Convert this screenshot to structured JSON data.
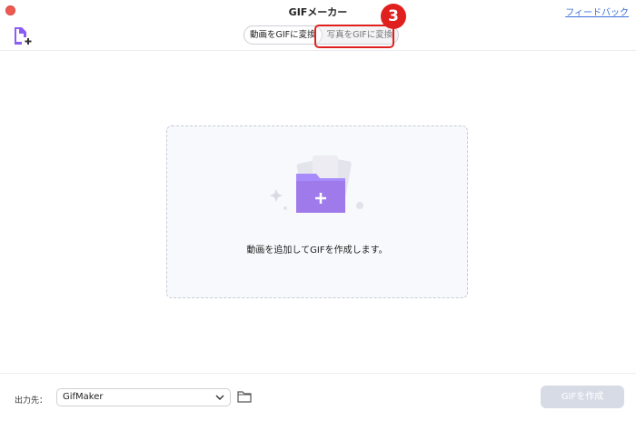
{
  "window": {
    "title": "GIFメーカー",
    "feedback_label": "フィードバック"
  },
  "header": {
    "add_icon": "add-file-icon",
    "tabs": [
      {
        "label": "動画をGIFに変換",
        "active": true
      },
      {
        "label": "写真をGIFに変換",
        "active": false
      }
    ]
  },
  "annotation": {
    "step_number": "3",
    "color": "#e0201f"
  },
  "dropzone": {
    "text": "動画を追加してGIFを作成します。",
    "icon": "folder-plus-icon"
  },
  "footer": {
    "output_label": "出力先：",
    "output_value": "GifMaker",
    "folder_icon": "folder-icon",
    "create_label": "GIFを作成",
    "create_enabled": false
  },
  "colors": {
    "accent": "#8b5cf6",
    "close": "#ee5a52",
    "link": "#3a6fd8",
    "disabled_button": "#d7dbe6"
  }
}
